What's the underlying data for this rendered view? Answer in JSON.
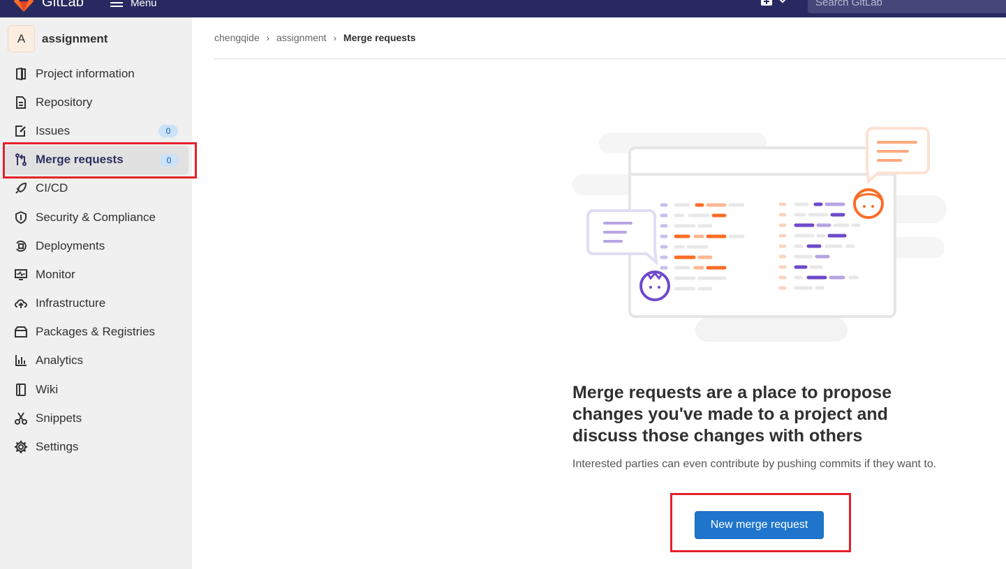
{
  "topbar": {
    "brand": "GitLab",
    "menu_label": "Menu",
    "search_placeholder": "Search GitLab"
  },
  "sidebar": {
    "project_avatar_letter": "A",
    "project_name": "assignment",
    "items": [
      {
        "label": "Project information",
        "icon": "project-info-icon"
      },
      {
        "label": "Repository",
        "icon": "repository-icon"
      },
      {
        "label": "Issues",
        "icon": "issues-icon",
        "badge": "0"
      },
      {
        "label": "Merge requests",
        "icon": "merge-request-icon",
        "badge": "0",
        "active": true
      },
      {
        "label": "CI/CD",
        "icon": "rocket-icon"
      },
      {
        "label": "Security & Compliance",
        "icon": "shield-icon"
      },
      {
        "label": "Deployments",
        "icon": "deployments-icon"
      },
      {
        "label": "Monitor",
        "icon": "monitor-icon"
      },
      {
        "label": "Infrastructure",
        "icon": "cloud-icon"
      },
      {
        "label": "Packages & Registries",
        "icon": "package-icon"
      },
      {
        "label": "Analytics",
        "icon": "chart-icon"
      },
      {
        "label": "Wiki",
        "icon": "book-icon"
      },
      {
        "label": "Snippets",
        "icon": "scissors-icon"
      },
      {
        "label": "Settings",
        "icon": "gear-icon"
      }
    ]
  },
  "breadcrumb": [
    "chengqide",
    "assignment",
    "Merge requests"
  ],
  "empty_state": {
    "title": "Merge requests are a place to propose changes you've made to a project and discuss those changes with others",
    "description": "Interested parties can even contribute by pushing commits if they want to.",
    "button_label": "New merge request"
  },
  "colors": {
    "topbar": "#292961",
    "sidebar": "#f0f0f0",
    "primary_button": "#1f75cb",
    "annotation": "#e5202b",
    "accent_orange": "#fc6d26",
    "accent_purple": "#6e49cb"
  }
}
